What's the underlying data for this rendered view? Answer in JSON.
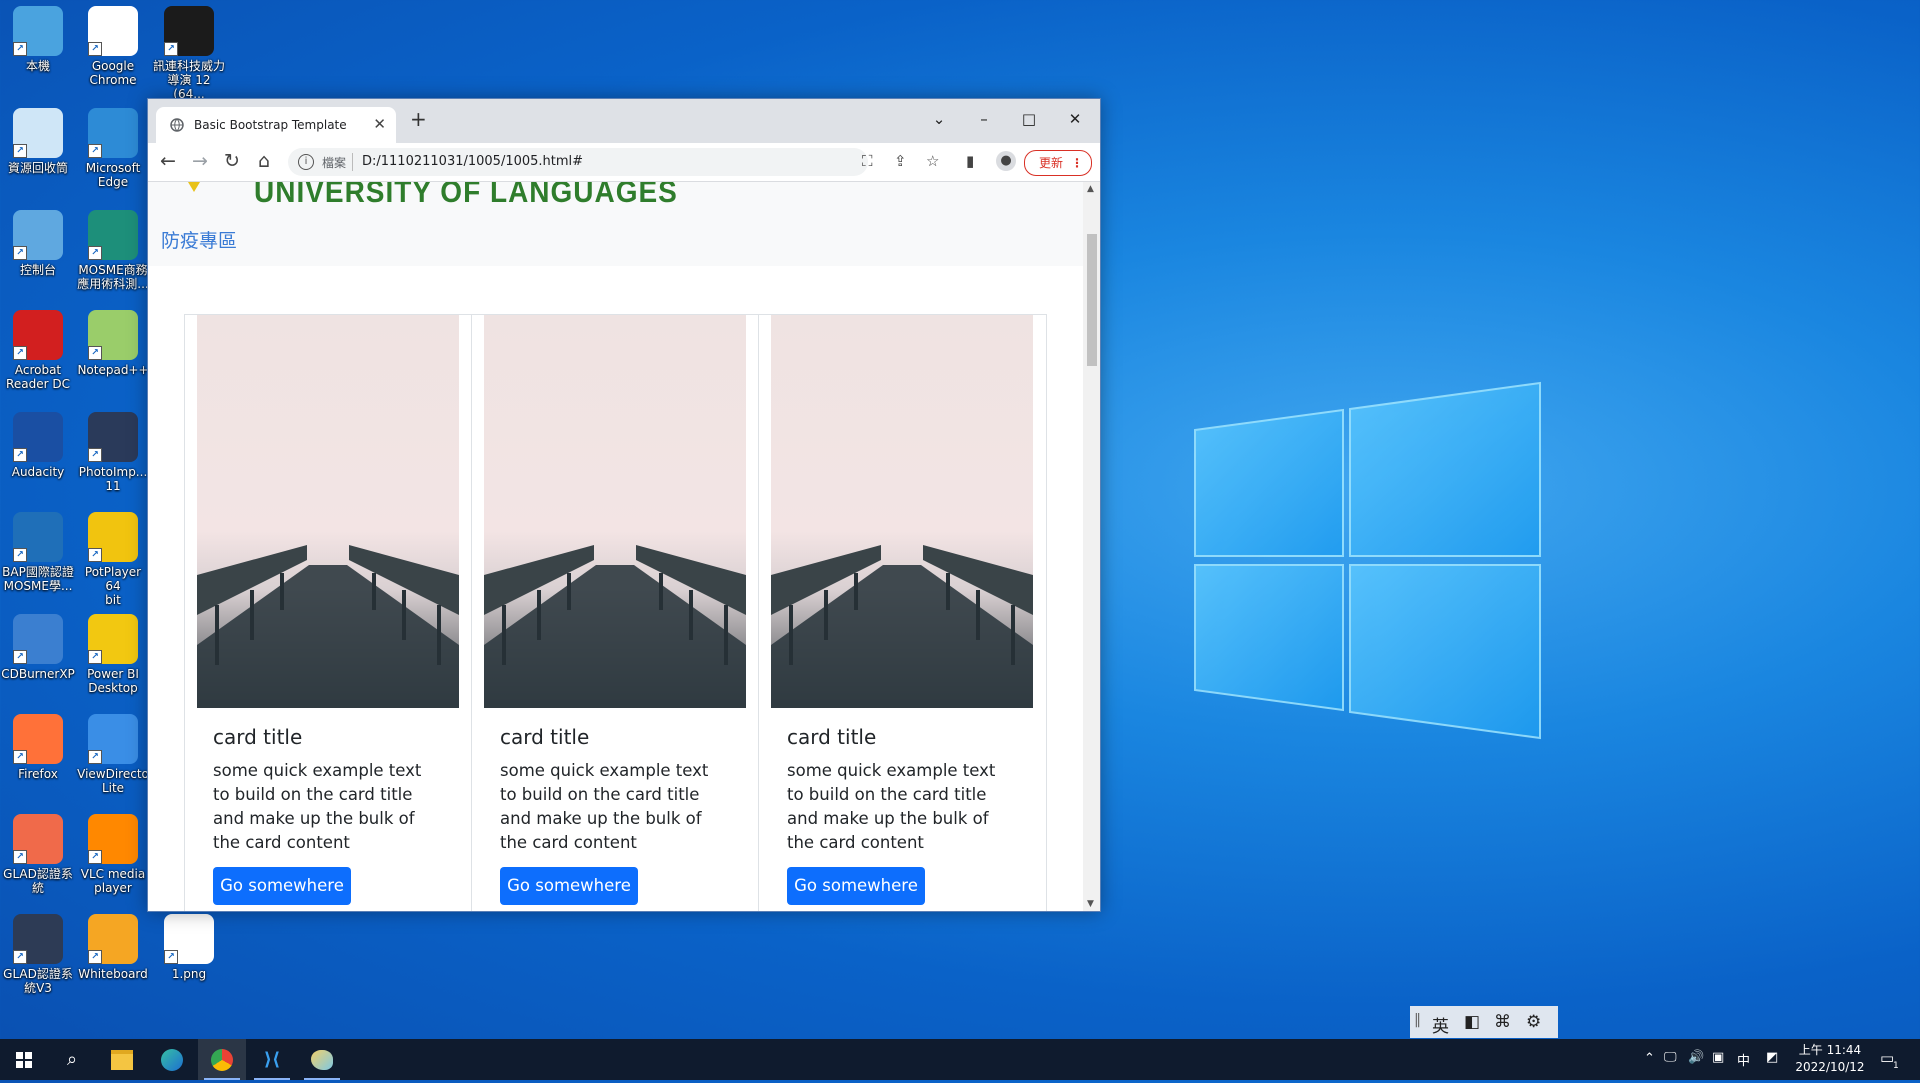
{
  "desktop": {
    "icons": [
      {
        "label": "本機",
        "icon": "computer-icon",
        "color": "#4aa3df"
      },
      {
        "label": "Google\nChrome",
        "icon": "chrome-icon",
        "color": "#ffffff"
      },
      {
        "label": "訊連科技威力\n導演 12 (64...",
        "icon": "powerdirector-icon",
        "color": "#1b1b1b"
      },
      {
        "label": "資源回收筒",
        "icon": "recycle-bin-icon",
        "color": "#cfe6f7"
      },
      {
        "label": "Microsoft\nEdge",
        "icon": "edge-icon",
        "color": "#2d8bd6"
      },
      {
        "label": "控制台",
        "icon": "control-panel-icon",
        "color": "#5fa8e0"
      },
      {
        "label": "MOSME商務\n應用術科測...",
        "icon": "mosme-icon",
        "color": "#1d8f7a"
      },
      {
        "label": "Acrobat\nReader DC",
        "icon": "acrobat-icon",
        "color": "#d21f1f"
      },
      {
        "label": "Notepad++",
        "icon": "notepad-plus-icon",
        "color": "#9acd6a"
      },
      {
        "label": "Audacity",
        "icon": "audacity-icon",
        "color": "#1a4fa3"
      },
      {
        "label": "PhotoImp...\n11",
        "icon": "photoimpact-icon",
        "color": "#2a3a5a"
      },
      {
        "label": "BAP國際認證\nMOSME學...",
        "icon": "bap-icon",
        "color": "#1f6fb8"
      },
      {
        "label": "PotPlayer 64\nbit",
        "icon": "potplayer-icon",
        "color": "#f1c40f"
      },
      {
        "label": "CDBurnerXP",
        "icon": "cdburner-icon",
        "color": "#3b7fd0"
      },
      {
        "label": "Power BI\nDesktop",
        "icon": "powerbi-icon",
        "color": "#f2c811"
      },
      {
        "label": "Firefox",
        "icon": "firefox-icon",
        "color": "#ff7139"
      },
      {
        "label": "ViewDirecto\nLite",
        "icon": "viewdirector-icon",
        "color": "#3a8ee6"
      },
      {
        "label": "GLAD認證系\n統",
        "icon": "glad-icon",
        "color": "#f06a4a"
      },
      {
        "label": "VLC media\nplayer",
        "icon": "vlc-icon",
        "color": "#ff8800"
      },
      {
        "label": "GLAD認證系\n統V3",
        "icon": "glad-v3-icon",
        "color": "#2d3b55"
      },
      {
        "label": "Whiteboard",
        "icon": "whiteboard-icon",
        "color": "#f5a623"
      },
      {
        "label": "1.png",
        "icon": "image-file-icon",
        "color": "#ffffff"
      }
    ]
  },
  "browser": {
    "tab_title": "Basic Bootstrap Template",
    "new_tab": "+",
    "window_controls": {
      "tab_search": "⌄",
      "minimize": "–",
      "maximize": "□",
      "close": "✕"
    },
    "url_scheme": "檔案",
    "url": "D:/1110211031/1005/1005.html#",
    "update_label": "更新"
  },
  "page": {
    "university": "UNIVERSITY OF LANGUAGES",
    "nav_link": "防疫專區",
    "cards": [
      {
        "title": "card title",
        "text": "some quick example text to build on the card title and make up the bulk of the card content",
        "button": "Go somewhere"
      },
      {
        "title": "card title",
        "text": "some quick example text to build on the card title and make up the bulk of the card content",
        "button": "Go somewhere"
      },
      {
        "title": "card title",
        "text": "some quick example text to build on the card title and make up the bulk of the card content",
        "button": "Go somewhere"
      }
    ],
    "accent": "#0d6efd"
  },
  "ime": {
    "lang": "英"
  },
  "taskbar": {
    "input_mode": "中",
    "time": "上午 11:44",
    "date": "2022/10/12",
    "notification_count": "1"
  }
}
